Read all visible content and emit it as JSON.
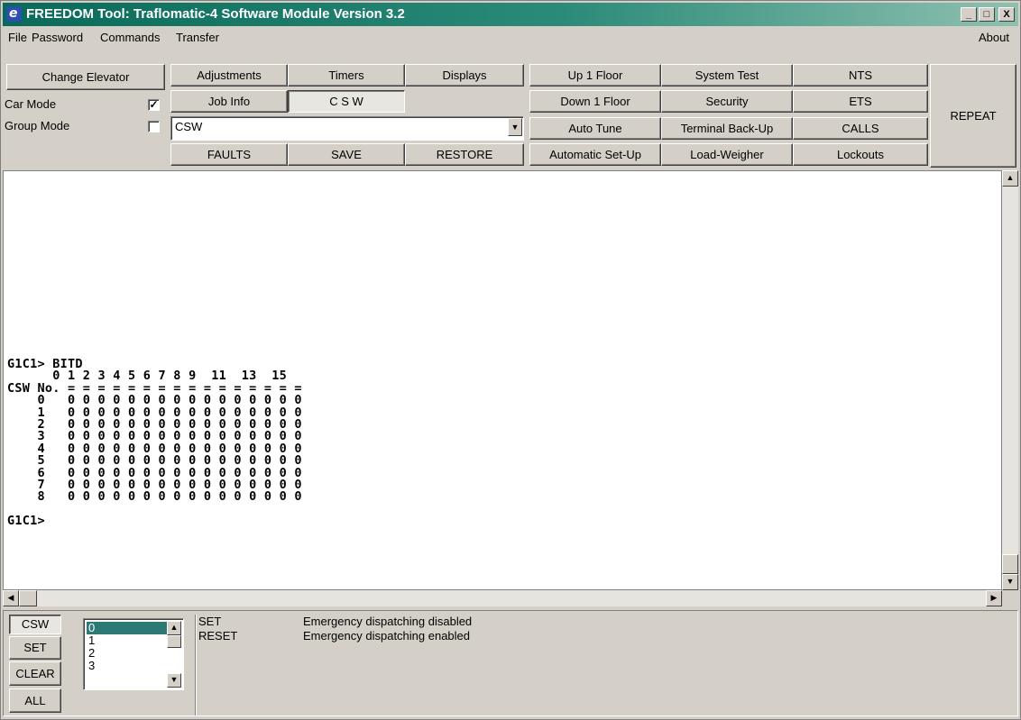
{
  "window": {
    "title": "FREEDOM Tool: Traflomatic-4 Software Module Version 3.2",
    "icon_letter": "e",
    "buttons": {
      "minimize": "_",
      "maximize": "□",
      "close": "X"
    }
  },
  "menu": {
    "file": "File",
    "password": "Password",
    "commands": "Commands",
    "transfer": "Transfer",
    "about": "About"
  },
  "toolbar": {
    "change_elevator": "Change Elevator",
    "car_mode_label": "Car Mode",
    "car_mode_checked": true,
    "group_mode_label": "Group Mode",
    "group_mode_checked": false,
    "combo_value": "CSW",
    "adjustments": "Adjustments",
    "timers": "Timers",
    "displays": "Displays",
    "job_info": "Job Info",
    "csw": "C S W",
    "faults": "FAULTS",
    "save": "SAVE",
    "restore": "RESTORE",
    "up_1_floor": "Up 1 Floor",
    "down_1_floor": "Down 1 Floor",
    "auto_tune": "Auto Tune",
    "automatic_setup": "Automatic Set-Up",
    "system_test": "System Test",
    "security": "Security",
    "terminal_backup": "Terminal Back-Up",
    "load_weigher": "Load-Weigher",
    "nts": "NTS",
    "ets": "ETS",
    "calls": "CALLS",
    "lockouts": "Lockouts",
    "repeat": "REPEAT"
  },
  "terminal": {
    "command_line": "G1C1> BITD",
    "header_line": "      0 1 2 3 4 5 6 7 8 9  11  13  15",
    "label_line": "CSW No. = = = = = = = = = = = = = = = =",
    "rows": [
      "    0   0 0 0 0 0 0 0 0 0 0 0 0 0 0 0 0",
      "    1   0 0 0 0 0 0 0 0 0 0 0 0 0 0 0 0",
      "    2   0 0 0 0 0 0 0 0 0 0 0 0 0 0 0 0",
      "    3   0 0 0 0 0 0 0 0 0 0 0 0 0 0 0 0",
      "    4   0 0 0 0 0 0 0 0 0 0 0 0 0 0 0 0",
      "    5   0 0 0 0 0 0 0 0 0 0 0 0 0 0 0 0",
      "    6   0 0 0 0 0 0 0 0 0 0 0 0 0 0 0 0",
      "    7   0 0 0 0 0 0 0 0 0 0 0 0 0 0 0 0",
      "    8   0 0 0 0 0 0 0 0 0 0 0 0 0 0 0 0"
    ],
    "prompt": "G1C1>"
  },
  "bottom": {
    "csw_button": "CSW",
    "set_button": "SET",
    "clear_button": "CLEAR",
    "all_button": "ALL",
    "list_items": [
      "0",
      "1",
      "2",
      "3"
    ],
    "selected_index": 0,
    "desc": [
      {
        "key": "SET",
        "text": "Emergency dispatching disabled"
      },
      {
        "key": "RESET",
        "text": "Emergency dispatching enabled"
      }
    ]
  },
  "colors": {
    "title_gradient_start": "#0a6a5a",
    "title_gradient_end": "#8fc0b0",
    "list_selection": "#2d7a74",
    "window_face": "#d4d0c8"
  }
}
